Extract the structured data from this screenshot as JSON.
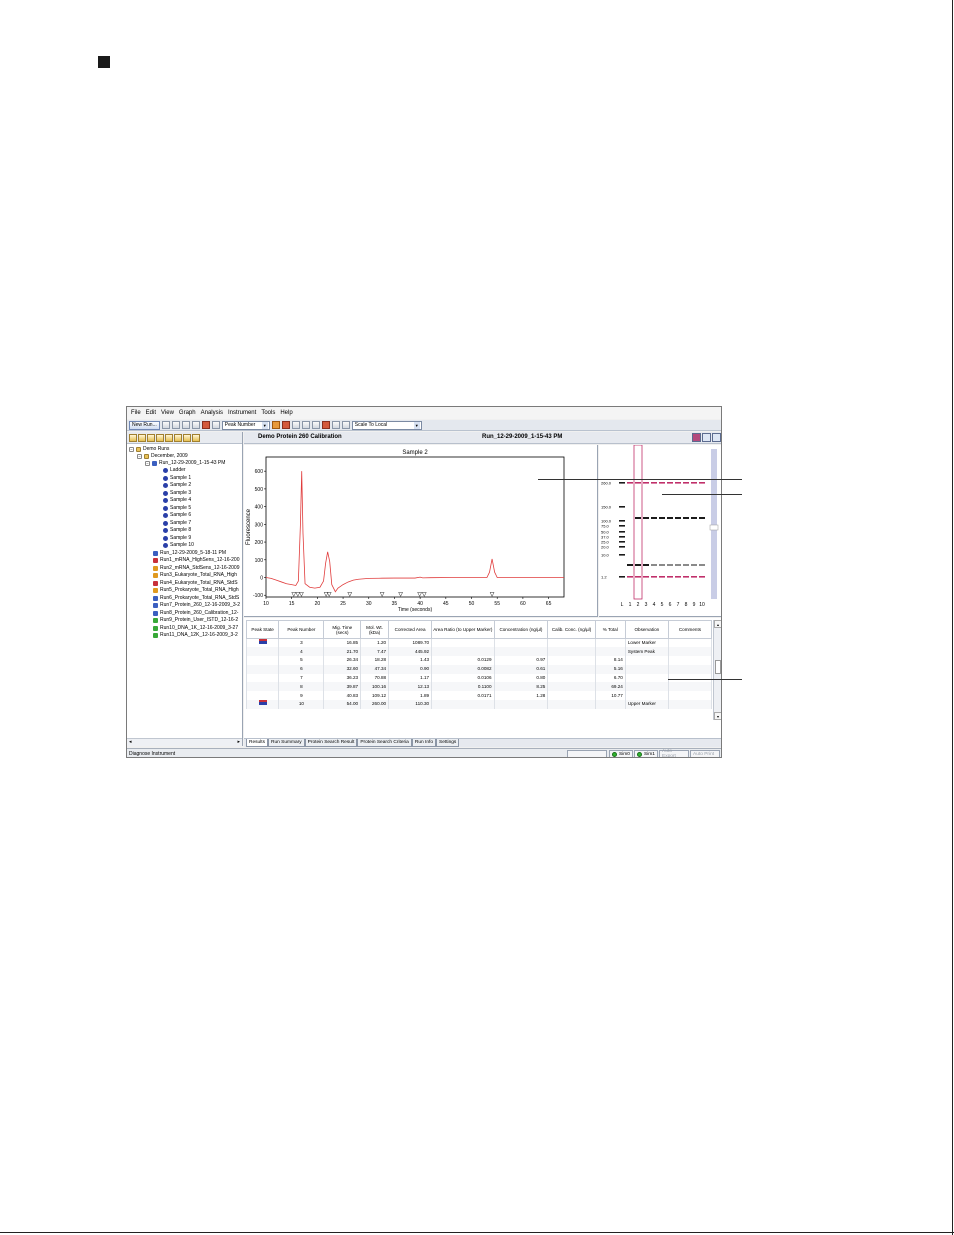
{
  "menu": [
    "File",
    "Edit",
    "View",
    "Graph",
    "Analysis",
    "Instrument",
    "Tools",
    "Help"
  ],
  "toolbar": {
    "new_run_label": "New Run...",
    "peak_select": "Peak Number",
    "scale_select": "Scale To Local"
  },
  "tree": {
    "root": "Demo Runs",
    "folder": "December, 2009",
    "current_run": "Run_12-29-2009_1-15-43 PM",
    "samples": [
      "Ladder",
      "Sample 1",
      "Sample 2",
      "Sample 3",
      "Sample 4",
      "Sample 5",
      "Sample 6",
      "Sample 7",
      "Sample 8",
      "Sample 9",
      "Sample 10"
    ],
    "other_runs": [
      "Run_12-29-2009_5-18-11 PM",
      "Run1_mRNA_HighSens_12-16-200",
      "Run2_mRNA_StdSens_12-16-2009",
      "Run3_Eukaryote_Total_RNA_High",
      "Run4_Eukaryote_Total_RNA_StdS",
      "Run5_Prokaryote_Total_RNA_High",
      "Run6_Prokaryote_Total_RNA_StdS",
      "Run7_Protein_260_12-16-2009_3-2",
      "Run8_Protein_260_Calibration_12-",
      "Run9_Protein_User_ISTD_12-16-2",
      "Run10_DNA_1K_12-16-2009_3-27",
      "Run11_DNA_12K_12-16-2009_3-2"
    ]
  },
  "header": {
    "assay_title": "Demo Protein 260 Calibration",
    "run_title": "Run_12-29-2009_1-15-43 PM"
  },
  "chart_data": {
    "type": "line",
    "title": "Sample 2",
    "xlabel": "Time (seconds)",
    "ylabel": "Fluorescence",
    "xlim": [
      10,
      68
    ],
    "ylim": [
      -110,
      680
    ],
    "x_ticks": [
      10,
      15,
      20,
      25,
      30,
      35,
      40,
      45,
      50,
      55,
      60,
      65
    ],
    "y_ticks": [
      -100,
      0,
      100,
      200,
      300,
      400,
      500,
      600
    ],
    "grid": false,
    "series": [
      {
        "color": "#e03c3c",
        "points": [
          [
            10,
            0
          ],
          [
            11,
            -5
          ],
          [
            12,
            -15
          ],
          [
            13,
            -25
          ],
          [
            14,
            -35
          ],
          [
            15,
            -40
          ],
          [
            15.8,
            -45
          ],
          [
            16.3,
            -20
          ],
          [
            16.7,
            300
          ],
          [
            16.95,
            600
          ],
          [
            17.2,
            250
          ],
          [
            17.6,
            -35
          ],
          [
            18.5,
            -55
          ],
          [
            19.5,
            -60
          ],
          [
            20.5,
            -55
          ],
          [
            21.2,
            -20
          ],
          [
            21.6,
            80
          ],
          [
            22,
            145
          ],
          [
            22.4,
            90
          ],
          [
            22.8,
            -40
          ],
          [
            23.5,
            -80
          ],
          [
            24,
            -60
          ],
          [
            25,
            -40
          ],
          [
            26,
            -25
          ],
          [
            27,
            -15
          ],
          [
            28,
            -10
          ],
          [
            30,
            -5
          ],
          [
            32,
            -4
          ],
          [
            35,
            -3
          ],
          [
            39,
            -3
          ],
          [
            40,
            2
          ],
          [
            40.5,
            -2
          ],
          [
            42,
            -1
          ],
          [
            46,
            0
          ],
          [
            50,
            0
          ],
          [
            53,
            0
          ],
          [
            53.5,
            30
          ],
          [
            54,
            105
          ],
          [
            54.5,
            30
          ],
          [
            55,
            0
          ],
          [
            60,
            0
          ],
          [
            65,
            0
          ],
          [
            68,
            0
          ]
        ]
      }
    ],
    "peak_markers_x": [
      15.4,
      16.2,
      16.9,
      21.7,
      22.3,
      26.3,
      32.6,
      36.2,
      39.9,
      40.8,
      54.0
    ]
  },
  "gel": {
    "ladder_labels": [
      "260.0",
      "150.0",
      "100.0",
      "75.0",
      "50.0",
      "37.0",
      "25.0",
      "20.0",
      "10.0",
      "1.2"
    ],
    "lane_labels": [
      "L",
      "1",
      "2",
      "3",
      "4",
      "5",
      "6",
      "7",
      "8",
      "9",
      "10"
    ],
    "highlight_lane": "2",
    "band_color": "#1b1b1b",
    "marker_color": "#c0306a"
  },
  "table": {
    "headers": [
      "Peak State",
      "Peak Number",
      "Mig. Time (secs)",
      "Mol. Wt. (kDa)",
      "Corrected Area",
      "Area Ratio (to Upper Marker)",
      "Concentration (ng/µl)",
      "Calib. Conc. (ng/µl)",
      "% Total",
      "Observation",
      "Comments"
    ],
    "rows": [
      {
        "flag": true,
        "peak": "3",
        "mig": "16.85",
        "mw": "1.20",
        "area": "1089.70",
        "ratio": "",
        "conc": "",
        "calib": "",
        "total": "",
        "obs": "Lower Marker"
      },
      {
        "flag": false,
        "peak": "4",
        "mig": "21.70",
        "mw": "7.47",
        "area": "445.92",
        "ratio": "",
        "conc": "",
        "calib": "",
        "total": "",
        "obs": "System Peak"
      },
      {
        "flag": false,
        "peak": "5",
        "mig": "26.34",
        "mw": "18.28",
        "area": "1.43",
        "ratio": "0.0129",
        "conc": "0.97",
        "calib": "",
        "total": "8.14",
        "obs": ""
      },
      {
        "flag": false,
        "peak": "6",
        "mig": "32.60",
        "mw": "47.34",
        "area": "0.90",
        "ratio": "0.0082",
        "conc": "0.61",
        "calib": "",
        "total": "5.16",
        "obs": ""
      },
      {
        "flag": false,
        "peak": "7",
        "mig": "36.23",
        "mw": "70.88",
        "area": "1.17",
        "ratio": "0.0106",
        "conc": "0.80",
        "calib": "",
        "total": "6.70",
        "obs": ""
      },
      {
        "flag": false,
        "peak": "8",
        "mig": "39.87",
        "mw": "100.16",
        "area": "12.13",
        "ratio": "0.1100",
        "conc": "8.25",
        "calib": "",
        "total": "69.24",
        "obs": ""
      },
      {
        "flag": false,
        "peak": "9",
        "mig": "40.83",
        "mw": "109.12",
        "area": "1.89",
        "ratio": "0.0171",
        "conc": "1.28",
        "calib": "",
        "total": "10.77",
        "obs": ""
      },
      {
        "flag": true,
        "peak": "10",
        "mig": "54.00",
        "mw": "260.00",
        "area": "110.30",
        "ratio": "",
        "conc": "",
        "calib": "",
        "total": "",
        "obs": "Upper Marker"
      }
    ]
  },
  "tabs": [
    "Results",
    "Run Summary",
    "Protein Search Result",
    "Protein Search Criteria",
    "Run Info",
    "Settings"
  ],
  "status": {
    "message": "Diagnose Instrument",
    "sim0": "Sim0",
    "sim1": "Sim1",
    "auto_export": "Auto Export",
    "auto_print": "Auto Print"
  }
}
